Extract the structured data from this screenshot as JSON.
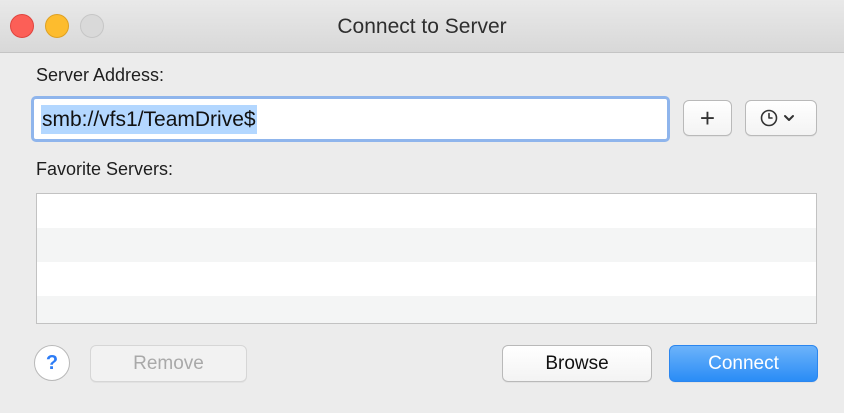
{
  "window": {
    "title": "Connect to Server"
  },
  "server_address": {
    "label": "Server Address:",
    "value": "smb://vfs1/TeamDrive$"
  },
  "favorites": {
    "label": "Favorite Servers:",
    "items": []
  },
  "buttons": {
    "add": "+",
    "help": "?",
    "remove": "Remove",
    "browse": "Browse",
    "connect": "Connect"
  },
  "icons": {
    "add": "plus-icon",
    "recent": "clock-icon",
    "recent_menu": "chevron-down-icon",
    "help": "help-icon"
  },
  "colors": {
    "accent": "#2a8cf6",
    "selection": "#b3d7ff",
    "close": "#fc5f57",
    "minimize": "#fdbc2e"
  }
}
